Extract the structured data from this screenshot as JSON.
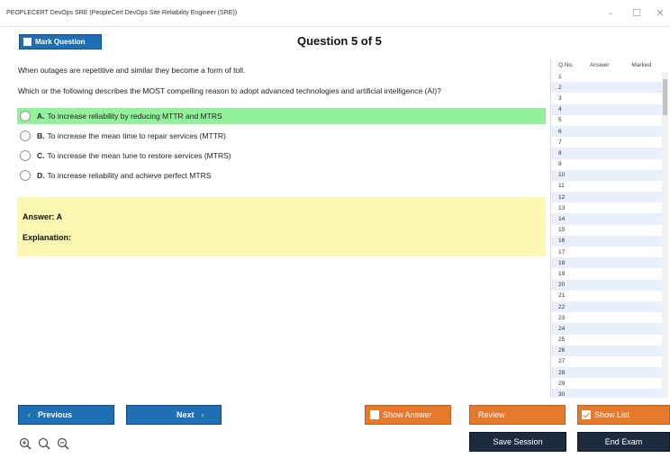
{
  "window": {
    "title": "PEOPLECERT DevOps SRE (PeopleCert DevOps Site Reliability Engineer (SRE))",
    "minimize_glyph": "–",
    "maximize_glyph": "☐",
    "close_glyph": "✕"
  },
  "toolbar": {
    "mark_label": "Mark Question",
    "header": "Question 5 of 5"
  },
  "question": {
    "stem_line1": "When outages are repetitive and similar they become a form of toll.",
    "stem_line2": "Which or the following describes the MOST compelling reason to adopt advanced technologies and artificial intelligence (AI)?",
    "options": [
      {
        "letter": "A.",
        "text": "To increase reliability by reducing MTTR and MTRS",
        "highlighted": true
      },
      {
        "letter": "B.",
        "text": "To increase the mean time to repair services (MTTR)",
        "highlighted": false
      },
      {
        "letter": "C.",
        "text": "To increase the mean tune to restore services (MTRS)",
        "highlighted": false
      },
      {
        "letter": "D.",
        "text": "To increase reliability and achieve perfect MTRS",
        "highlighted": false
      }
    ]
  },
  "answer_panel": {
    "answer_line": "Answer: A",
    "explanation_label": "Explanation:"
  },
  "question_list": {
    "headers": {
      "no": "Q.No.",
      "answer": "Answer",
      "marked": "Marked"
    },
    "rows": [
      "1",
      "2",
      "3",
      "4",
      "5",
      "6",
      "7",
      "8",
      "9",
      "10",
      "11",
      "12",
      "13",
      "14",
      "15",
      "16",
      "17",
      "18",
      "19",
      "20",
      "21",
      "22",
      "23",
      "24",
      "25",
      "26",
      "27",
      "28",
      "29",
      "30"
    ]
  },
  "buttons": {
    "previous": "Previous",
    "next": "Next",
    "show_answer": "Show Answer",
    "review": "Review",
    "show_list": "Show List",
    "save_session": "Save Session",
    "end_exam": "End Exam",
    "prev_chevron": "‹",
    "next_chevron": "›"
  },
  "colors": {
    "primary_blue": "#1f6fb5",
    "accent_orange": "#e5792e",
    "navy": "#1d2b3f",
    "correct_green": "#93f09b",
    "answer_yellow": "#fcf7b2"
  },
  "icons": [
    "zoom-in-icon",
    "zoom-reset-icon",
    "zoom-out-icon"
  ]
}
